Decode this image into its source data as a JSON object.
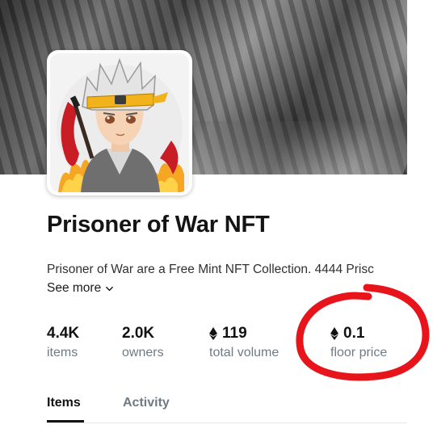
{
  "collection": {
    "name": "Prisoner of War NFT",
    "description": "Prisoner of War are a Free Mint NFT Collection. 4444 Prisc",
    "see_more_label": "See more"
  },
  "stats": [
    {
      "value": "4.4K",
      "label": "items",
      "eth": false
    },
    {
      "value": "2.0K",
      "label": "owners",
      "eth": false
    },
    {
      "value": "119",
      "label": "total volume",
      "eth": true
    },
    {
      "value": "0.1",
      "label": "floor price",
      "eth": true
    }
  ],
  "tabs": [
    {
      "label": "Items",
      "active": true
    },
    {
      "label": "Activity",
      "active": false
    }
  ],
  "colors": {
    "annotation": "#e8141c",
    "headband": "#f2b21c",
    "flames": "#f5a623",
    "muted_text": "#707a83"
  },
  "icons": {
    "eth": "ethereum-icon",
    "chevron": "chevron-down-icon"
  }
}
